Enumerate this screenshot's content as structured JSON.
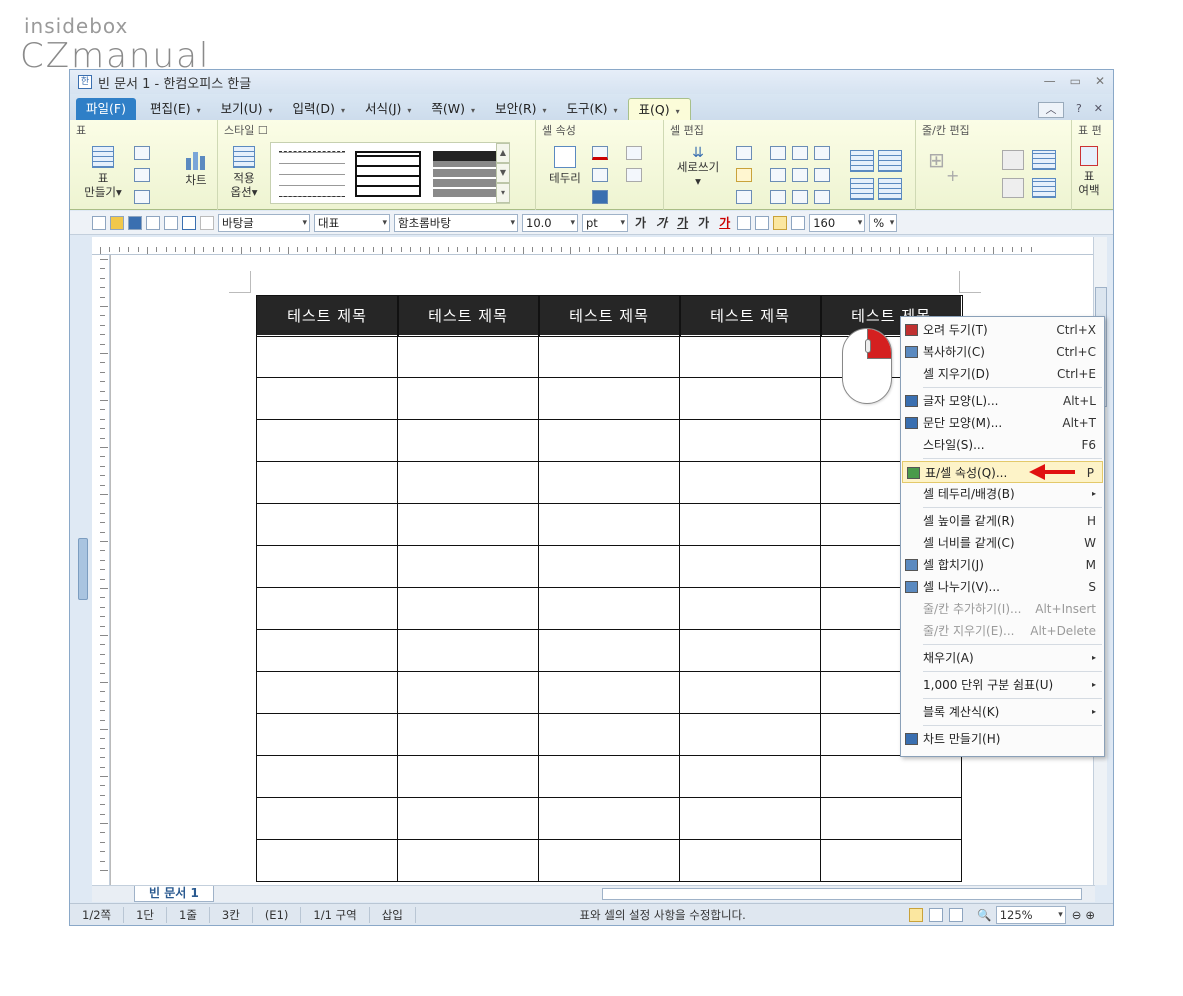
{
  "watermark": {
    "line1": "insidebox",
    "line2": "CZmanual"
  },
  "window": {
    "title": "빈 문서 1 - 한컴오피스 한글",
    "controls": [
      "—",
      "▭",
      "✕"
    ]
  },
  "menubar": {
    "items": [
      "파일(F)",
      "편집(E)",
      "보기(U)",
      "입력(D)",
      "서식(J)",
      "쪽(W)",
      "보안(R)",
      "도구(K)",
      "표(Q)"
    ],
    "ribbon_controls": [
      "︿",
      "?",
      "✕"
    ]
  },
  "ribbon": {
    "groups": {
      "table": "표",
      "style": "스타일 ☐",
      "cellprop": "셀 속성",
      "celledit": "셀 편집",
      "rowcol": "줄/칸 편집",
      "margin": "표 편"
    },
    "buttons": {
      "make_table": "표\n만들기▾",
      "chart": "차트",
      "apply_opt": "적용\n옵션▾",
      "border": "테두리",
      "vertical": "세로쓰기",
      "margin": "표\n여백"
    }
  },
  "toolbar": {
    "style_sel": "바탕글",
    "rep_sel": "대표",
    "font_sel": "함초롬바탕",
    "size_sel": "10.0",
    "unit_sel": "pt",
    "spacing_sel": "160",
    "pct": "%",
    "fmt": [
      "가",
      "가",
      "가",
      "가",
      "가"
    ]
  },
  "table": {
    "headers": [
      "테스트 제목",
      "테스트 제목",
      "테스트 제목",
      "테스트 제목",
      "테스트 제목"
    ],
    "rows": 13
  },
  "context_menu": {
    "items": [
      {
        "label": "오려 두기(T)",
        "shortcut": "Ctrl+X",
        "icon": "scissors-icon"
      },
      {
        "label": "복사하기(C)",
        "shortcut": "Ctrl+C",
        "icon": "copy-icon"
      },
      {
        "label": "셀 지우기(D)",
        "shortcut": "Ctrl+E",
        "icon": ""
      },
      {
        "sep": true
      },
      {
        "label": "글자 모양(L)...",
        "shortcut": "Alt+L",
        "icon": "char-shape-icon"
      },
      {
        "label": "문단 모양(M)...",
        "shortcut": "Alt+T",
        "icon": "para-shape-icon"
      },
      {
        "label": "스타일(S)...",
        "shortcut": "F6",
        "icon": ""
      },
      {
        "sep": true
      },
      {
        "label": "표/셀 속성(Q)...",
        "shortcut": "P",
        "icon": "table-prop-icon",
        "highlight": true
      },
      {
        "label": "셀 테두리/배경(B)",
        "shortcut": "",
        "icon": "",
        "sub": true
      },
      {
        "sep": true
      },
      {
        "label": "셀 높이를 같게(R)",
        "shortcut": "H",
        "icon": ""
      },
      {
        "label": "셀 너비를 같게(C)",
        "shortcut": "W",
        "icon": ""
      },
      {
        "label": "셀 합치기(J)",
        "shortcut": "M",
        "icon": "merge-icon"
      },
      {
        "label": "셀 나누기(V)...",
        "shortcut": "S",
        "icon": "split-icon"
      },
      {
        "label": "줄/칸 추가하기(I)...",
        "shortcut": "Alt+Insert",
        "icon": "",
        "disabled": true
      },
      {
        "label": "줄/칸 지우기(E)...",
        "shortcut": "Alt+Delete",
        "icon": "",
        "disabled": true
      },
      {
        "sep": true
      },
      {
        "label": "채우기(A)",
        "shortcut": "",
        "icon": "",
        "sub": true
      },
      {
        "sep": true
      },
      {
        "label": "1,000 단위 구분 쉼표(U)",
        "shortcut": "",
        "icon": "",
        "sub": true
      },
      {
        "sep": true
      },
      {
        "label": "블록 계산식(K)",
        "shortcut": "",
        "icon": "",
        "sub": true
      },
      {
        "sep": true
      },
      {
        "label": "차트 만들기(H)",
        "shortcut": "",
        "icon": "chart-icon"
      }
    ]
  },
  "tabbar": {
    "doc_tab": "빈 문서 1"
  },
  "status": {
    "page": "1/2쪽",
    "col": "1단",
    "line": "1줄",
    "kan": "3칸",
    "cell": "(E1)",
    "section": "1/1 구역",
    "mode": "삽입",
    "message": "표와 셀의 설정 사항을 수정합니다.",
    "zoom": "125%"
  },
  "colors": {
    "accent": "#2f7fc7",
    "header_bg": "#262626",
    "highlight": "#fdf3c8",
    "arrow": "#e01010"
  }
}
